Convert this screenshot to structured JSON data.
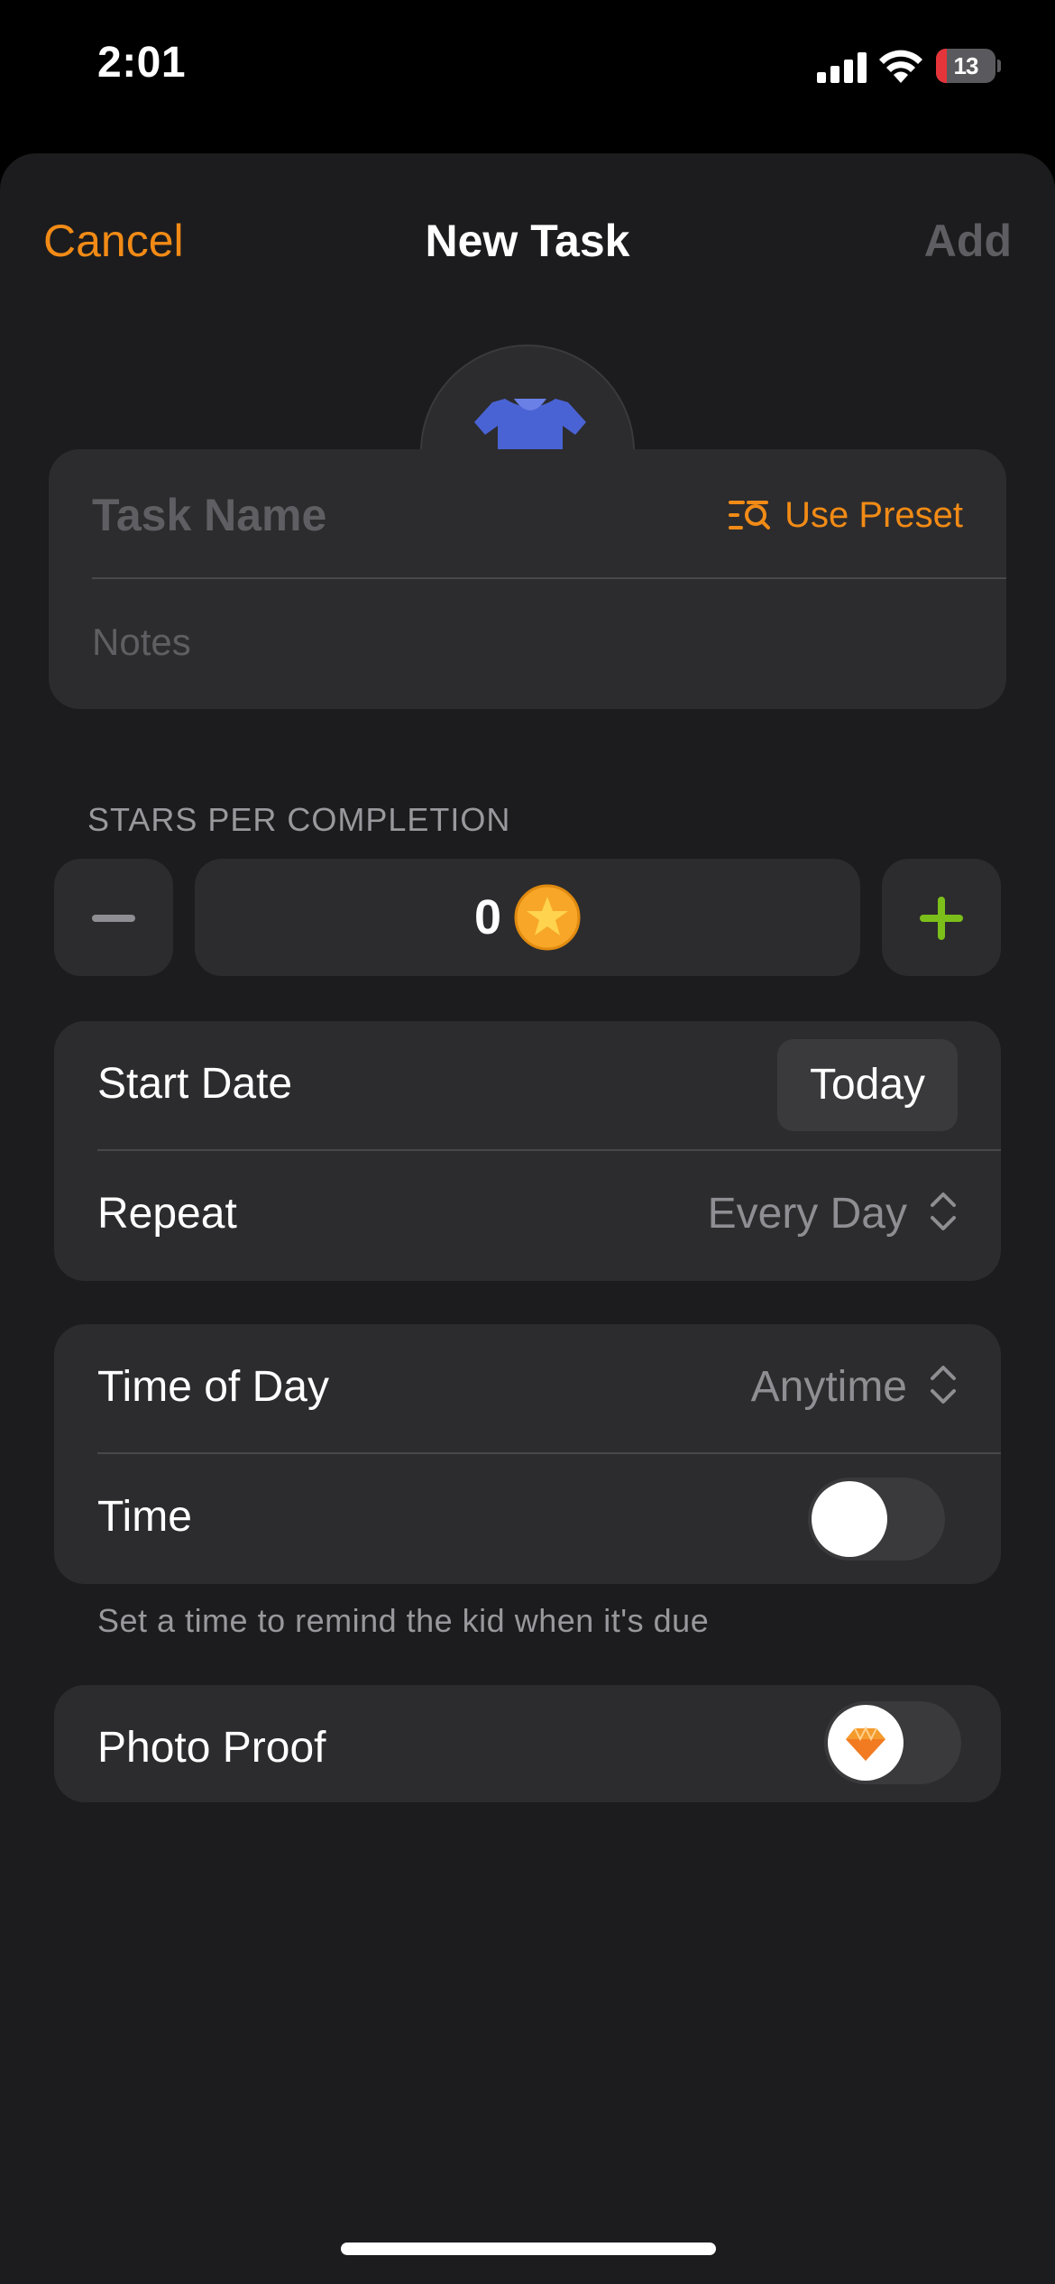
{
  "status_bar": {
    "time": "2:01",
    "battery_level": "13",
    "battery_fraction": 0.13,
    "icons": [
      "signal-icon",
      "wifi-icon",
      "battery-icon"
    ]
  },
  "nav": {
    "cancel_label": "Cancel",
    "title": "New Task",
    "add_label": "Add"
  },
  "avatar": {
    "icon": "shirt-clothes-icon",
    "edit_icon": "pencil-icon"
  },
  "task": {
    "name_placeholder": "Task Name",
    "use_preset_label": "Use Preset",
    "notes_placeholder": "Notes"
  },
  "stars": {
    "section_label": "STARS PER COMPLETION",
    "value": "0",
    "icon": "star-coin-icon"
  },
  "schedule": {
    "start_date_label": "Start Date",
    "start_date_value": "Today",
    "repeat_label": "Repeat",
    "repeat_value": "Every Day"
  },
  "timing": {
    "time_of_day_label": "Time of Day",
    "time_of_day_value": "Anytime",
    "time_label": "Time",
    "time_enabled": false,
    "hint": "Set a time to remind the kid when it's due"
  },
  "proof": {
    "photo_proof_label": "Photo Proof",
    "enabled": false,
    "icon": "gem-icon"
  },
  "colors": {
    "accent": "#f28b16",
    "green": "#7cbf1a",
    "background": "#1c1c1e",
    "card": "#2c2c2e"
  }
}
